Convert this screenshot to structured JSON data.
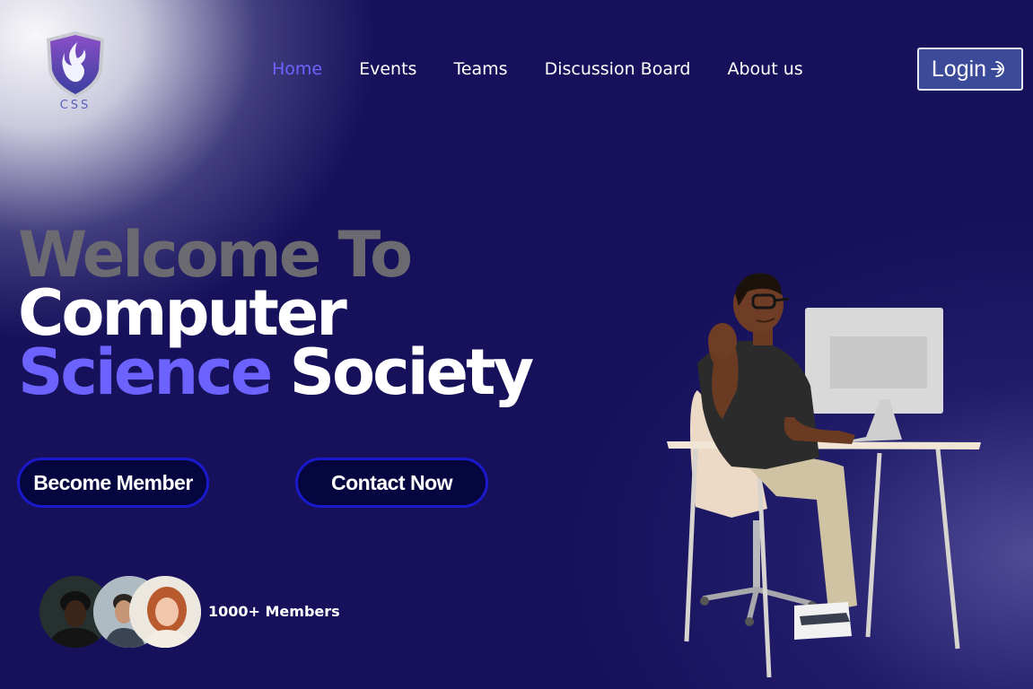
{
  "brand": {
    "logo_text": "CSS",
    "icon": "shield-flame-logo"
  },
  "nav": {
    "items": [
      {
        "label": "Home",
        "active": true
      },
      {
        "label": "Events",
        "active": false
      },
      {
        "label": "Teams",
        "active": false
      },
      {
        "label": "Discussion Board",
        "active": false
      },
      {
        "label": "About us",
        "active": false
      }
    ],
    "login_label": "Login",
    "login_icon": "login-arrow-icon"
  },
  "hero": {
    "line1": "Welcome To",
    "line2": "Computer",
    "line3_accent": "Science",
    "line3_rest": "Society"
  },
  "cta": {
    "member_label": "Become Member",
    "contact_label": "Contact Now"
  },
  "members": {
    "label": "1000+ Members"
  },
  "colors": {
    "background": "#16115a",
    "accent": "#6c63ff",
    "button_bg": "#050540",
    "button_border": "#1a1acc"
  }
}
